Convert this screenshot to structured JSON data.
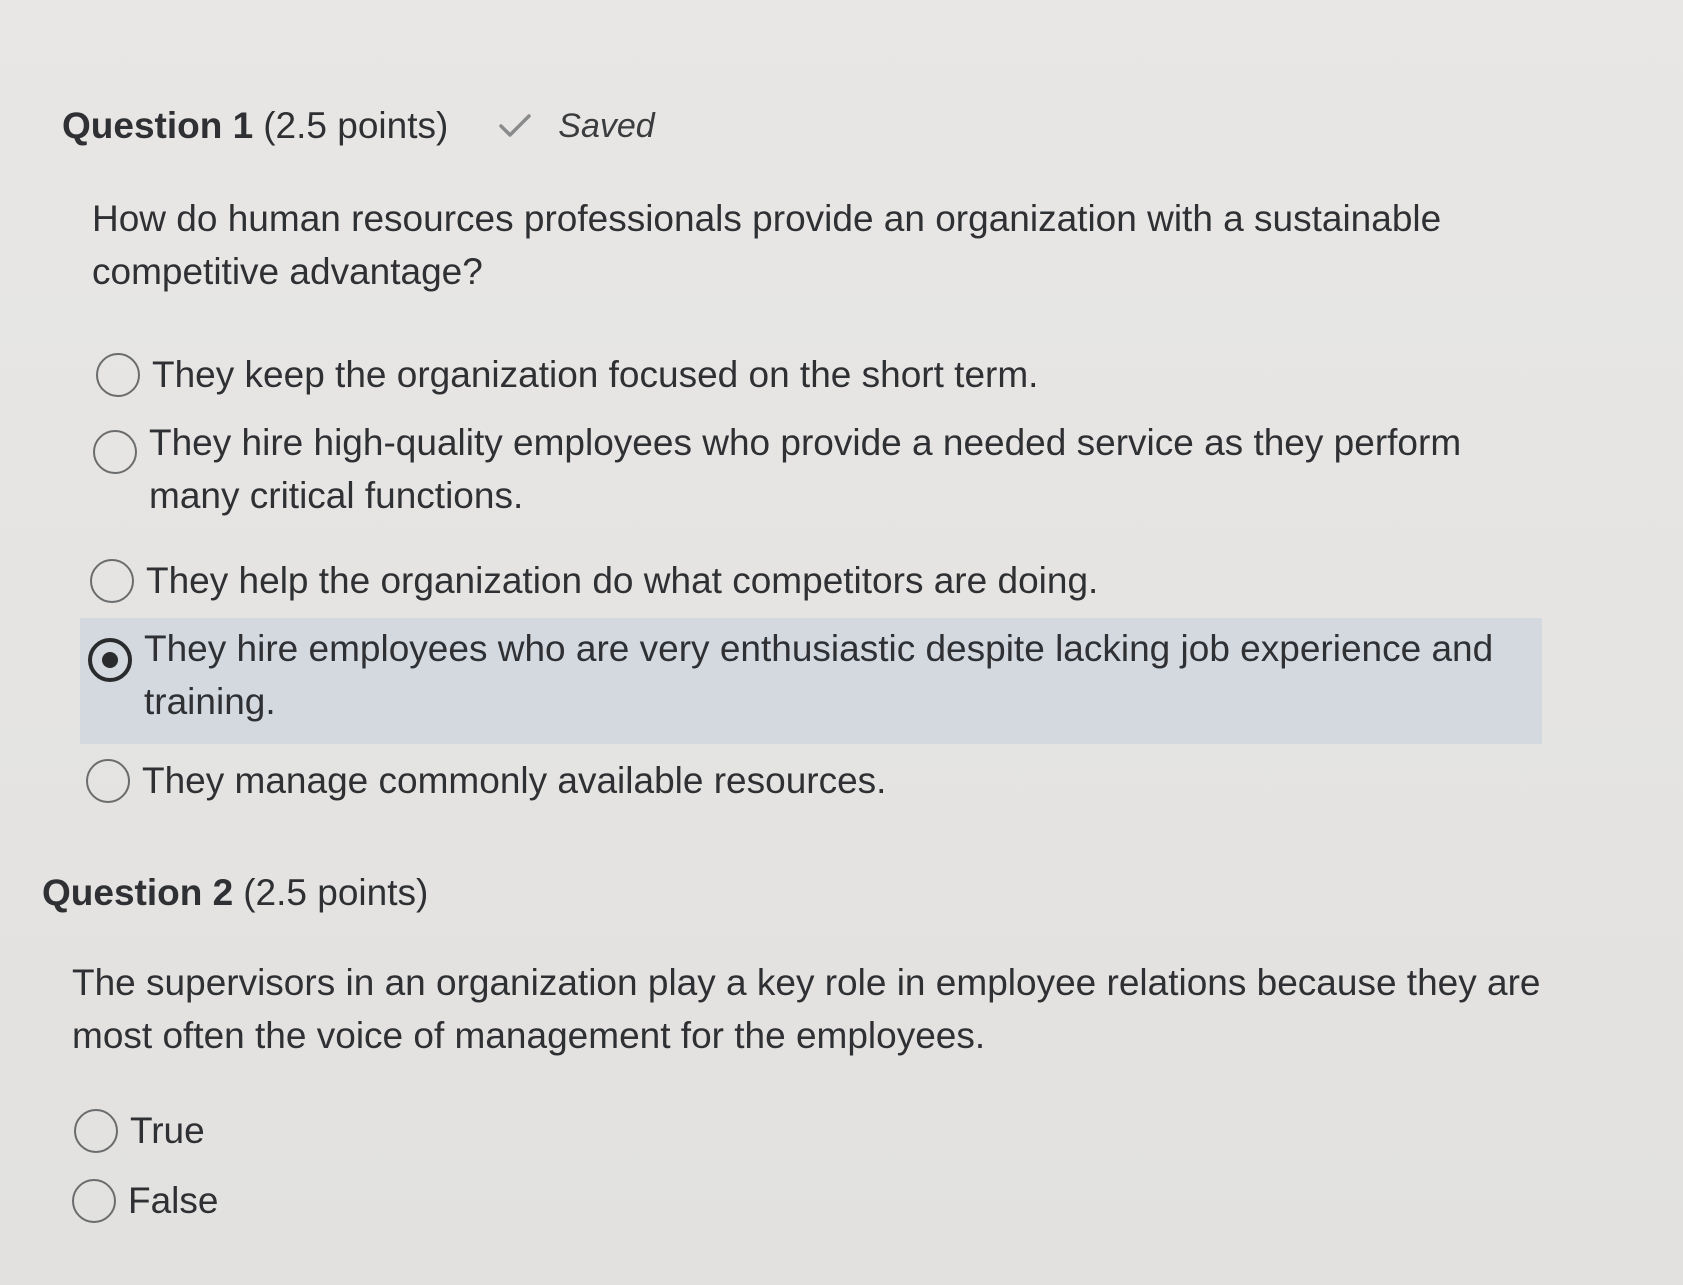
{
  "questions": [
    {
      "title": "Question 1",
      "points": "(2.5 points)",
      "status": "Saved",
      "status_icon": "check-icon",
      "text": "How do human resources professionals provide an organization with a sustainable competitive advantage?",
      "options": [
        {
          "label": "They keep the organization focused on the short term.",
          "selected": false
        },
        {
          "label": "They hire high-quality employees who provide a needed service as they perform many critical functions.",
          "selected": false
        },
        {
          "label": "They help the organization do what competitors are doing.",
          "selected": false
        },
        {
          "label": "They hire employees who are very enthusiastic despite lacking job experience and training.",
          "selected": true
        },
        {
          "label": "They manage commonly available resources.",
          "selected": false
        }
      ]
    },
    {
      "title": "Question 2",
      "points": "(2.5 points)",
      "text": "The supervisors in an organization play a key role in employee relations because they are most often the voice of management for the employees.",
      "options": [
        {
          "label": "True",
          "selected": false
        },
        {
          "label": "False",
          "selected": false
        }
      ]
    }
  ],
  "colors": {
    "selected_highlight": "#d3d9de",
    "background": "#e7e6e4",
    "text": "#2f3033"
  }
}
